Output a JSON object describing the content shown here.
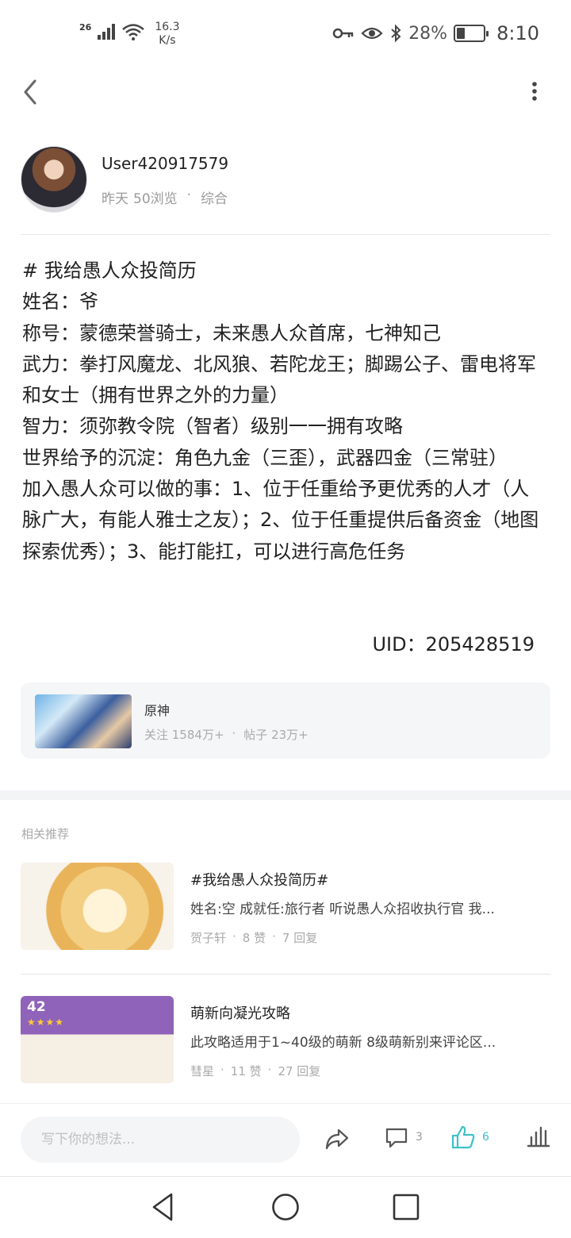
{
  "status_bar": {
    "network": "26",
    "speed_value": "16.3",
    "speed_unit": "K/s",
    "battery": "28%",
    "time": "8:10"
  },
  "author": {
    "username": "User420917579",
    "time": "昨天",
    "views": "50浏览",
    "separator": "·",
    "category": "综合"
  },
  "post": {
    "lines": [
      "# 我给愚人众投简历",
      "姓名：爷",
      "称号：蒙德荣誉骑士，未来愚人众首席，七神知己",
      "武力：拳打风魔龙、北风狼、若陀龙王；脚踢公子、雷电将军和女士（拥有世界之外的力量）",
      "智力：须弥教令院（智者）级别一一拥有攻略",
      "世界给予的沉淀：角色九金（三歪），武器四金（三常驻）",
      "加入愚人众可以做的事：1、位于任重给予更优秀的人才（人脉广大，有能人雅士之友）；2、位于任重提供后备资金（地图探索优秀）；3、能打能扛，可以进行高危任务"
    ],
    "uid": "UID：205428519"
  },
  "game_card": {
    "name": "原神",
    "followers": "关注 1584万+",
    "separator": "·",
    "posts": "帖子 23万+"
  },
  "related": {
    "title": "相关推荐",
    "items": [
      {
        "title": "#我给愚人众投简历#",
        "desc": "姓名:空 成就任:旅行者 听说愚人众招收执行官 我...",
        "author": "贺子轩",
        "likes": "8 赞",
        "replies": "7 回复"
      },
      {
        "title": "萌新向凝光攻略",
        "desc": "此攻略适用于1~40级的萌新 8级萌新别来评论区...",
        "author": "彗星",
        "likes": "11 赞",
        "replies": "27 回复",
        "thumb_level": "42",
        "thumb_stars": "★★★★"
      }
    ]
  },
  "action_bar": {
    "comment_placeholder": "写下你的想法...",
    "comment_count": "3",
    "like_count": "6"
  },
  "colors": {
    "accent": "#3ec0c6",
    "muted": "#9a9a9a",
    "card_bg": "#f5f6f8"
  }
}
